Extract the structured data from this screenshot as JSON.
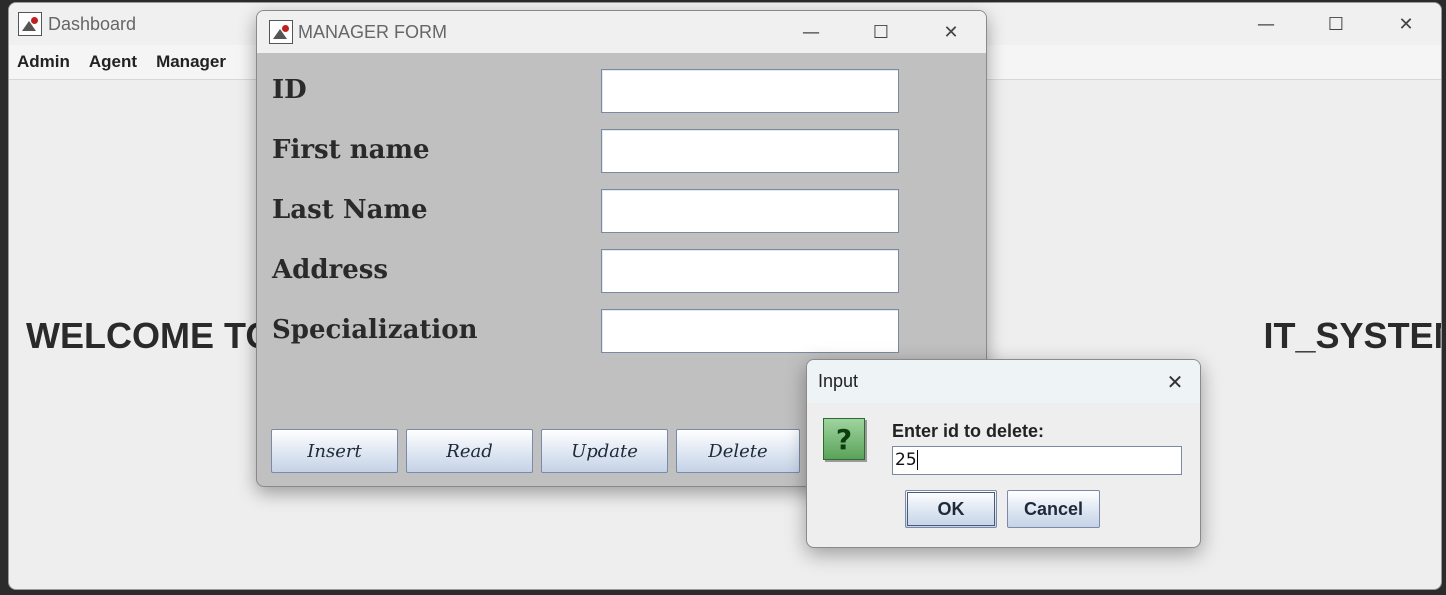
{
  "dashboard": {
    "title": "Dashboard",
    "window_controls": {
      "minimize": "—",
      "maximize": "☐",
      "close": "✕"
    },
    "menu": [
      "Admin",
      "Agent",
      "Manager"
    ],
    "welcome_text": "WELCOME TO                                                                                                   IT_SYSTEM DASHBOARD"
  },
  "manager_form": {
    "title": "MANAGER FORM",
    "window_controls": {
      "minimize": "—",
      "maximize": "☐",
      "close": "✕"
    },
    "fields": [
      {
        "label": "ID",
        "value": ""
      },
      {
        "label": "First name",
        "value": ""
      },
      {
        "label": "Last Name",
        "value": ""
      },
      {
        "label": "Address",
        "value": ""
      },
      {
        "label": "Specialization",
        "value": ""
      }
    ],
    "buttons": [
      "Insert",
      "Read",
      "Update",
      "Delete"
    ]
  },
  "input_dialog": {
    "title": "Input",
    "close": "✕",
    "icon": "?",
    "prompt": "Enter id to delete:",
    "value": "25",
    "ok_label": "OK",
    "cancel_label": "Cancel"
  },
  "colors": {
    "form_background": "#c0c0c0",
    "dashboard_background": "#eeeeee",
    "question_icon": "#5aa35a"
  }
}
